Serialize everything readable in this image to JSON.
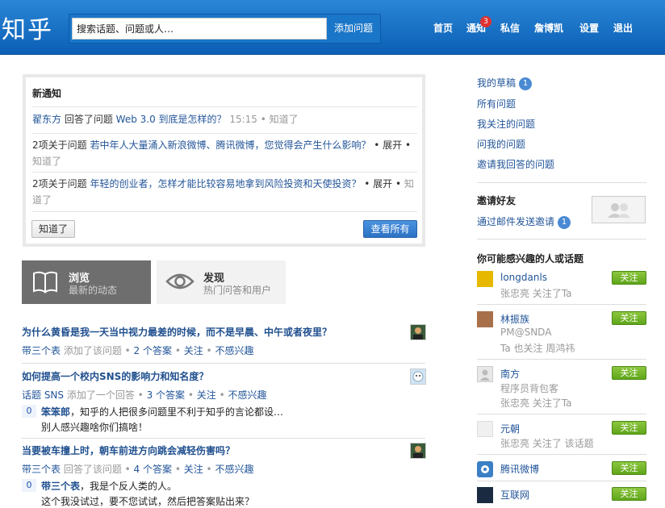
{
  "header": {
    "logo": "知乎",
    "search_placeholder": "搜索话题、问题或人…",
    "ask_button": "添加问题",
    "nav": [
      "首页",
      "通知",
      "私信",
      "詹博凯",
      "设置",
      "退出"
    ],
    "notify_count": "3"
  },
  "notice": {
    "title": "新通知",
    "rows": [
      {
        "user": "翟东方",
        "action": " 回答了问题 ",
        "question": "Web 3.0 到底是怎样的？",
        "time": " 15:15 • ",
        "known": "知道了"
      },
      {
        "prefix": "2项关于问题 ",
        "question": "若中年人大量涌入新浪微博、腾讯微博，您觉得会产生什么影响？",
        "expand": " • 展开 • ",
        "known": "知道了"
      },
      {
        "prefix": "2项关于问题 ",
        "question": "年轻的创业者，怎样才能比较容易地拿到风险投资和天使投资？",
        "expand": " • 展开 • ",
        "known": "知道了"
      }
    ],
    "known_button": "知道了",
    "viewall_button": "查看所有"
  },
  "tabs": {
    "browse": {
      "title": "浏览",
      "sub": "最新的动态"
    },
    "discover": {
      "title": "发现",
      "sub": "热门问答和用户"
    }
  },
  "feed": [
    {
      "question": "为什么黄昏是我一天当中视力最差的时候，而不是早晨、中午或者夜里？",
      "meta_user": "带三个表",
      "meta_action": " 添加了该问题 • ",
      "meta_answers": "2 个答案",
      "meta_sep1": " • ",
      "meta_follow": "关注",
      "meta_sep2": " • ",
      "meta_noint": "不感兴趣"
    },
    {
      "question": "如何提高一个校内SNS的影响力和知名度？",
      "meta_user": "话题 SNS",
      "meta_action": " 添加了一个回答 • ",
      "meta_answers": "3 个答案",
      "meta_sep1": " • ",
      "meta_follow": "关注",
      "meta_sep2": " • ",
      "meta_noint": "不感兴趣",
      "answer": {
        "votes": "0",
        "author": "笨笨郎",
        "text1": "，知乎的人把很多问题里不利于知乎的言论都设…",
        "text2": "别人感兴趣啥你们搞啥！"
      }
    },
    {
      "question": "当要被车撞上时，朝车前进方向跳会减轻伤害吗？",
      "meta_user": "带三个表",
      "meta_action": " 回答了该问题 • ",
      "meta_answers": "4 个答案",
      "meta_sep1": " • ",
      "meta_follow": "关注",
      "meta_sep2": " • ",
      "meta_noint": "不感兴趣",
      "answer": {
        "votes": "0",
        "author": "带三个表",
        "text1": "，我是个反人类的人。",
        "text2": "这个我没试过，要不您试试，然后把答案贴出来？"
      }
    }
  ],
  "sidebar": {
    "links": [
      "我的草稿",
      "所有问题",
      "我关注的问题",
      "问我的问题",
      "邀请我回答的问题"
    ],
    "draft_count": "1",
    "invite_title": "邀请好友",
    "invite_link": "通过邮件发送邀请",
    "invite_count": "1",
    "rec_title": "你可能感兴趣的人或话题",
    "follow_label": "关注",
    "recs": [
      {
        "name": "longdanls",
        "desc1": "张忠亮 关注了Ta",
        "desc2": ""
      },
      {
        "name": "林振族",
        "desc1": "PM@SNDA",
        "desc2": "Ta 也关注 周鸿祎"
      },
      {
        "name": "南方",
        "desc1": "程序员背包客",
        "desc2": "张忠亮 关注了Ta"
      },
      {
        "name": "元朝",
        "desc1": "张忠亮 关注了 该话题",
        "desc2": ""
      },
      {
        "name": "腾讯微博",
        "desc1": "",
        "desc2": ""
      },
      {
        "name": "互联网",
        "desc1": "",
        "desc2": ""
      }
    ]
  },
  "colors": {
    "header": "#1a70c4",
    "follow": "#6fb327",
    "link": "#225599"
  }
}
